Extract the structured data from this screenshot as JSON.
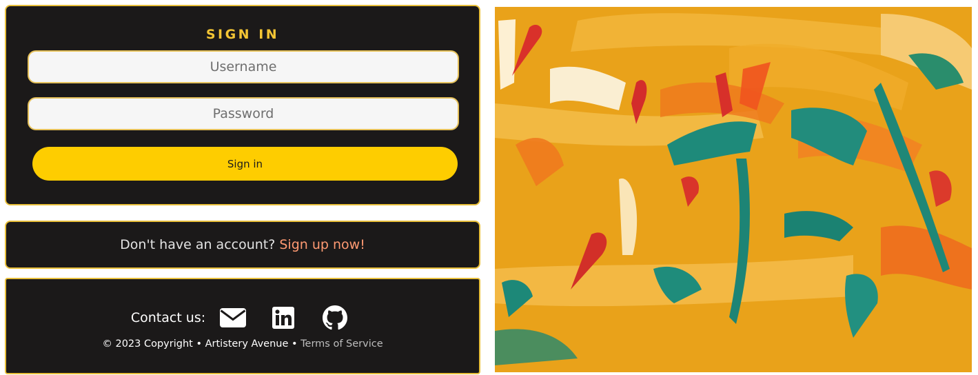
{
  "signin": {
    "title": "SIGN IN",
    "username_placeholder": "Username",
    "password_placeholder": "Password",
    "button_label": "Sign in"
  },
  "signup": {
    "prompt": "Don't have an account?",
    "link_label": "Sign up now!"
  },
  "footer": {
    "contact_label": "Contact us:",
    "social_icons": [
      "envelope-icon",
      "linkedin-icon",
      "github-icon"
    ],
    "copyright": "© 2023 Copyright • Artistery Avenue •",
    "terms_label": "Terms of Service"
  },
  "colors": {
    "panel_bg": "#1b1919",
    "panel_border": "#e8bf3a",
    "accent_yellow": "#fecd00",
    "title_gold": "#f3c534",
    "signup_link": "#ff9a72",
    "art_base": "#e9a21a"
  }
}
